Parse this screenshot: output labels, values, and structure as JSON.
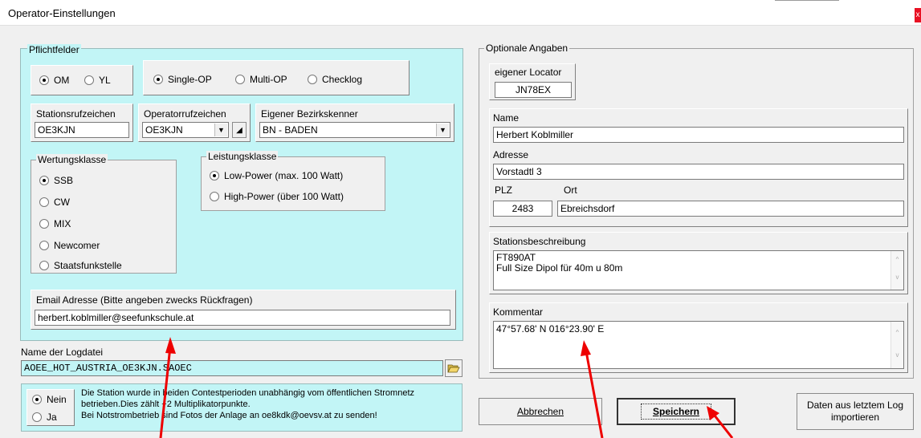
{
  "window": {
    "title": "Operator-Einstellungen",
    "close_glyph": "x"
  },
  "pflicht": {
    "title": "Pflichtfelder",
    "gender": {
      "om": "OM",
      "yl": "YL",
      "selected": "OM"
    },
    "operation": {
      "single": "Single-OP",
      "multi": "Multi-OP",
      "checklog": "Checklog",
      "selected": "Single-OP"
    },
    "station_call": {
      "label": "Stationsrufzeichen",
      "value": "OE3KJN"
    },
    "operator_call": {
      "label": "Operatorrufzeichen",
      "value": "OE3KJN"
    },
    "district": {
      "label": "Eigener Bezirkskenner",
      "value": "BN - BADEN"
    },
    "class": {
      "title": "Wertungsklasse",
      "options": [
        "SSB",
        "CW",
        "MIX",
        "Newcomer",
        "Staatsfunkstelle"
      ],
      "selected": "SSB"
    },
    "power": {
      "title": "Leistungsklasse",
      "options": [
        "Low-Power (max. 100 Watt)",
        "High-Power (über 100 Watt)"
      ],
      "selected": "Low-Power (max. 100 Watt)"
    },
    "email": {
      "label": "Email Adresse (Bitte angeben zwecks Rückfragen)",
      "value": "herbert.koblmiller@seefunkschule.at"
    }
  },
  "logfile": {
    "label": "Name der Logdatei",
    "value": "AOEE_HOT_AUSTRIA_OE3KJN.SAOEC"
  },
  "emergency": {
    "no": "Nein",
    "yes": "Ja",
    "selected": "Nein",
    "text1": "Die Station wurde in beiden Contestperioden unabhängig vom öffentlichen Stromnetz",
    "text2": "betrieben.Dies zählt +2 Multiplikatorpunkte.",
    "text3": "Bei Notstrombetrieb sind Fotos der Anlage an  oe8kdk@oevsv.at  zu senden!"
  },
  "optional": {
    "title": "Optionale Angaben",
    "locator": {
      "label": "eigener Locator",
      "value": "JN78EX"
    },
    "name": {
      "label": "Name",
      "value": "Herbert Koblmiller"
    },
    "address": {
      "label": "Adresse",
      "value": "Vorstadtl 3"
    },
    "plz": {
      "label": "PLZ",
      "value": "2483"
    },
    "ort": {
      "label": "Ort",
      "value": "Ebreichsdorf"
    },
    "description": {
      "label": "Stationsbeschreibung",
      "line1": "FT890AT",
      "line2": "Full Size Dipol für 40m u 80m"
    },
    "comment": {
      "label": "Kommentar",
      "value": "47°57.68' N 016°23.90' E"
    }
  },
  "buttons": {
    "cancel": "Abbrechen",
    "save": "Speichern",
    "import_line1": "Daten aus letztem Log",
    "import_line2": "importieren"
  },
  "colors": {
    "panel_bg": "#c2f5f6",
    "arrow": "#ee0000",
    "close": "#e81123"
  }
}
